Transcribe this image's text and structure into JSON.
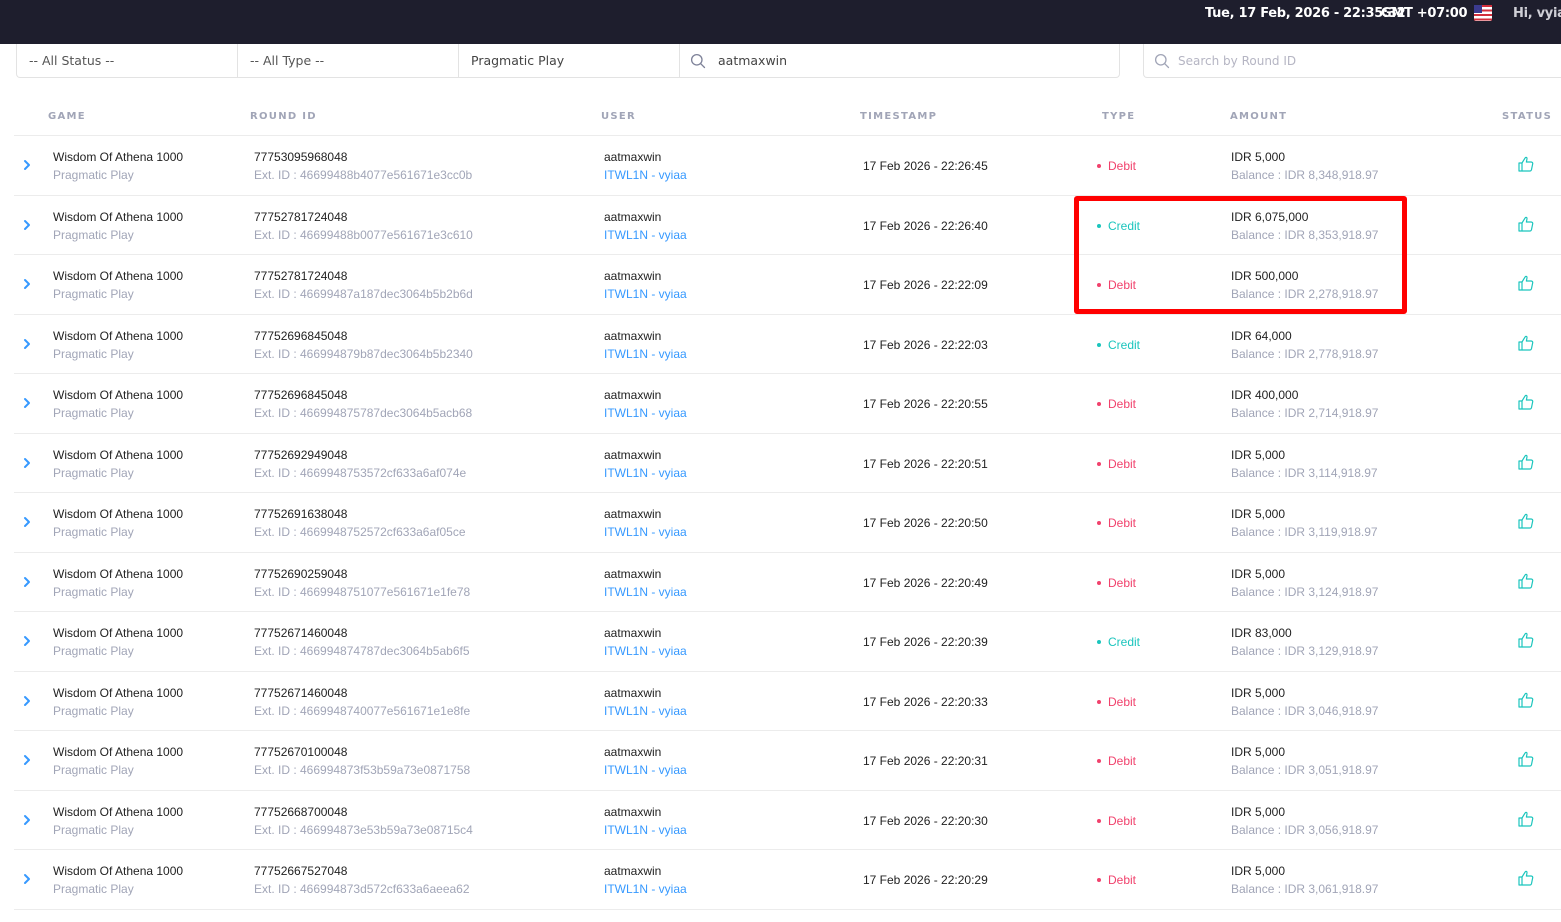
{
  "header": {
    "datetime": "Tue, 17 Feb, 2026 - 22:35:32",
    "timezone": "GMT +07:00",
    "flag_icon": "us-flag-icon",
    "greeting": "Hi, vyiac"
  },
  "filters": {
    "status": "-- All Status --",
    "type": "-- All Type --",
    "provider": "Pragmatic Play",
    "user_search": "aatmaxwin",
    "round_placeholder": "Search by Round ID"
  },
  "columns": {
    "game": "GAME",
    "round_id": "ROUND ID",
    "user": "USER",
    "timestamp": "TIMESTAMP",
    "type": "TYPE",
    "amount": "AMOUNT",
    "status": "STATUS"
  },
  "colors": {
    "topbar": "#1e1e2d",
    "debit": "#f1416c",
    "credit": "#1bc5bd",
    "link": "#3699ff",
    "highlight": "#ff0000"
  },
  "rows": [
    {
      "game": "Wisdom Of Athena 1000",
      "provider": "Pragmatic Play",
      "round_id": "77753095968048",
      "ext_id": "Ext. ID : 46699488b4077e561671e3cc0b",
      "user": "aatmaxwin",
      "agent": "ITWL1N - vyiaa",
      "timestamp": "17 Feb 2026 - 22:26:45",
      "type": "Debit",
      "amount": "IDR 5,000",
      "balance": "Balance : IDR 8,348,918.97",
      "status_icon": "thumbs-up-icon"
    },
    {
      "game": "Wisdom Of Athena 1000",
      "provider": "Pragmatic Play",
      "round_id": "77752781724048",
      "ext_id": "Ext. ID : 46699488b0077e561671e3c610",
      "user": "aatmaxwin",
      "agent": "ITWL1N - vyiaa",
      "timestamp": "17 Feb 2026 - 22:26:40",
      "type": "Credit",
      "amount": "IDR 6,075,000",
      "balance": "Balance : IDR 8,353,918.97",
      "status_icon": "thumbs-up-icon"
    },
    {
      "game": "Wisdom Of Athena 1000",
      "provider": "Pragmatic Play",
      "round_id": "77752781724048",
      "ext_id": "Ext. ID : 46699487a187dec3064b5b2b6d",
      "user": "aatmaxwin",
      "agent": "ITWL1N - vyiaa",
      "timestamp": "17 Feb 2026 - 22:22:09",
      "type": "Debit",
      "amount": "IDR 500,000",
      "balance": "Balance : IDR 2,278,918.97",
      "status_icon": "thumbs-up-icon"
    },
    {
      "game": "Wisdom Of Athena 1000",
      "provider": "Pragmatic Play",
      "round_id": "77752696845048",
      "ext_id": "Ext. ID : 466994879b87dec3064b5b2340",
      "user": "aatmaxwin",
      "agent": "ITWL1N - vyiaa",
      "timestamp": "17 Feb 2026 - 22:22:03",
      "type": "Credit",
      "amount": "IDR 64,000",
      "balance": "Balance : IDR 2,778,918.97",
      "status_icon": "thumbs-up-icon"
    },
    {
      "game": "Wisdom Of Athena 1000",
      "provider": "Pragmatic Play",
      "round_id": "77752696845048",
      "ext_id": "Ext. ID : 466994875787dec3064b5acb68",
      "user": "aatmaxwin",
      "agent": "ITWL1N - vyiaa",
      "timestamp": "17 Feb 2026 - 22:20:55",
      "type": "Debit",
      "amount": "IDR 400,000",
      "balance": "Balance : IDR 2,714,918.97",
      "status_icon": "thumbs-up-icon"
    },
    {
      "game": "Wisdom Of Athena 1000",
      "provider": "Pragmatic Play",
      "round_id": "77752692949048",
      "ext_id": "Ext. ID : 4669948753572cf633a6af074e",
      "user": "aatmaxwin",
      "agent": "ITWL1N - vyiaa",
      "timestamp": "17 Feb 2026 - 22:20:51",
      "type": "Debit",
      "amount": "IDR 5,000",
      "balance": "Balance : IDR 3,114,918.97",
      "status_icon": "thumbs-up-icon"
    },
    {
      "game": "Wisdom Of Athena 1000",
      "provider": "Pragmatic Play",
      "round_id": "77752691638048",
      "ext_id": "Ext. ID : 4669948752572cf633a6af05ce",
      "user": "aatmaxwin",
      "agent": "ITWL1N - vyiaa",
      "timestamp": "17 Feb 2026 - 22:20:50",
      "type": "Debit",
      "amount": "IDR 5,000",
      "balance": "Balance : IDR 3,119,918.97",
      "status_icon": "thumbs-up-icon"
    },
    {
      "game": "Wisdom Of Athena 1000",
      "provider": "Pragmatic Play",
      "round_id": "77752690259048",
      "ext_id": "Ext. ID : 4669948751077e561671e1fe78",
      "user": "aatmaxwin",
      "agent": "ITWL1N - vyiaa",
      "timestamp": "17 Feb 2026 - 22:20:49",
      "type": "Debit",
      "amount": "IDR 5,000",
      "balance": "Balance : IDR 3,124,918.97",
      "status_icon": "thumbs-up-icon"
    },
    {
      "game": "Wisdom Of Athena 1000",
      "provider": "Pragmatic Play",
      "round_id": "77752671460048",
      "ext_id": "Ext. ID : 466994874787dec3064b5ab6f5",
      "user": "aatmaxwin",
      "agent": "ITWL1N - vyiaa",
      "timestamp": "17 Feb 2026 - 22:20:39",
      "type": "Credit",
      "amount": "IDR 83,000",
      "balance": "Balance : IDR 3,129,918.97",
      "status_icon": "thumbs-up-icon"
    },
    {
      "game": "Wisdom Of Athena 1000",
      "provider": "Pragmatic Play",
      "round_id": "77752671460048",
      "ext_id": "Ext. ID : 4669948740077e561671e1e8fe",
      "user": "aatmaxwin",
      "agent": "ITWL1N - vyiaa",
      "timestamp": "17 Feb 2026 - 22:20:33",
      "type": "Debit",
      "amount": "IDR 5,000",
      "balance": "Balance : IDR 3,046,918.97",
      "status_icon": "thumbs-up-icon"
    },
    {
      "game": "Wisdom Of Athena 1000",
      "provider": "Pragmatic Play",
      "round_id": "77752670100048",
      "ext_id": "Ext. ID : 466994873f53b59a73e0871758",
      "user": "aatmaxwin",
      "agent": "ITWL1N - vyiaa",
      "timestamp": "17 Feb 2026 - 22:20:31",
      "type": "Debit",
      "amount": "IDR 5,000",
      "balance": "Balance : IDR 3,051,918.97",
      "status_icon": "thumbs-up-icon"
    },
    {
      "game": "Wisdom Of Athena 1000",
      "provider": "Pragmatic Play",
      "round_id": "77752668700048",
      "ext_id": "Ext. ID : 466994873e53b59a73e08715c4",
      "user": "aatmaxwin",
      "agent": "ITWL1N - vyiaa",
      "timestamp": "17 Feb 2026 - 22:20:30",
      "type": "Debit",
      "amount": "IDR 5,000",
      "balance": "Balance : IDR 3,056,918.97",
      "status_icon": "thumbs-up-icon"
    },
    {
      "game": "Wisdom Of Athena 1000",
      "provider": "Pragmatic Play",
      "round_id": "77752667527048",
      "ext_id": "Ext. ID : 466994873d572cf633a6aeea62",
      "user": "aatmaxwin",
      "agent": "ITWL1N - vyiaa",
      "timestamp": "17 Feb 2026 - 22:20:29",
      "type": "Debit",
      "amount": "IDR 5,000",
      "balance": "Balance : IDR 3,061,918.97",
      "status_icon": "thumbs-up-icon"
    }
  ]
}
